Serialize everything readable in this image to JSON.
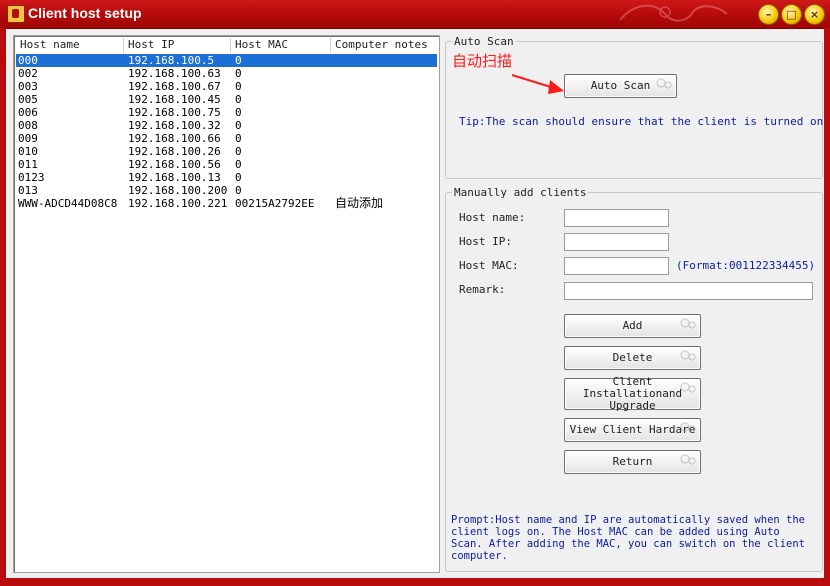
{
  "window": {
    "title": "Client host setup",
    "min_glyph": "–",
    "max_glyph": "□",
    "close_glyph": "×"
  },
  "list": {
    "columns": [
      "Host name",
      "Host IP",
      "Host MAC",
      "Computer notes"
    ],
    "rows": [
      {
        "name": "000",
        "ip": "192.168.100.5",
        "mac": "0",
        "note": ""
      },
      {
        "name": "002",
        "ip": "192.168.100.63",
        "mac": "0",
        "note": ""
      },
      {
        "name": "003",
        "ip": "192.168.100.67",
        "mac": "0",
        "note": ""
      },
      {
        "name": "005",
        "ip": "192.168.100.45",
        "mac": "0",
        "note": ""
      },
      {
        "name": "006",
        "ip": "192.168.100.75",
        "mac": "0",
        "note": ""
      },
      {
        "name": "008",
        "ip": "192.168.100.32",
        "mac": "0",
        "note": ""
      },
      {
        "name": "009",
        "ip": "192.168.100.66",
        "mac": "0",
        "note": ""
      },
      {
        "name": "010",
        "ip": "192.168.100.26",
        "mac": "0",
        "note": ""
      },
      {
        "name": "011",
        "ip": "192.168.100.56",
        "mac": "0",
        "note": ""
      },
      {
        "name": "0123",
        "ip": "192.168.100.13",
        "mac": "0",
        "note": ""
      },
      {
        "name": "013",
        "ip": "192.168.100.200",
        "mac": "0",
        "note": ""
      },
      {
        "name": "WWW-ADCD44D08C8",
        "ip": "192.168.100.221",
        "mac": "00215A2792EE",
        "note": "自动添加"
      }
    ]
  },
  "auto_scan": {
    "group_title": "Auto Scan",
    "annotation": "自动扫描",
    "button": "Auto Scan",
    "tip": "Tip:The scan should ensure that the client is turned on"
  },
  "manual": {
    "group_title": "Manually add clients",
    "host_name_label": "Host name:",
    "host_ip_label": "Host IP:",
    "host_mac_label": "Host MAC:",
    "mac_format": "(Format:001122334455)",
    "remark_label": "Remark:",
    "host_name_value": "",
    "host_ip_value": "",
    "host_mac_value": "",
    "remark_value": "",
    "buttons": {
      "add": "Add",
      "delete": "Delete",
      "install": "Client Installationand Upgrade",
      "view": "View Client Hardare",
      "return": "Return"
    },
    "prompt": "Prompt:Host name and IP are automatically saved when the client logs on. The Host MAC can be added using Auto Scan. After adding the MAC, you can switch on the client computer."
  },
  "colors": {
    "title_bar": "#b40a0a",
    "selection": "#1c6fd6",
    "annotation": "#ff1a1a",
    "tip_text": "#1020a0"
  },
  "icons": {
    "app": "app-icon",
    "minimize": "minimize-icon",
    "maximize": "maximize-icon",
    "close": "close-icon",
    "arrow": "red-arrow-icon"
  }
}
